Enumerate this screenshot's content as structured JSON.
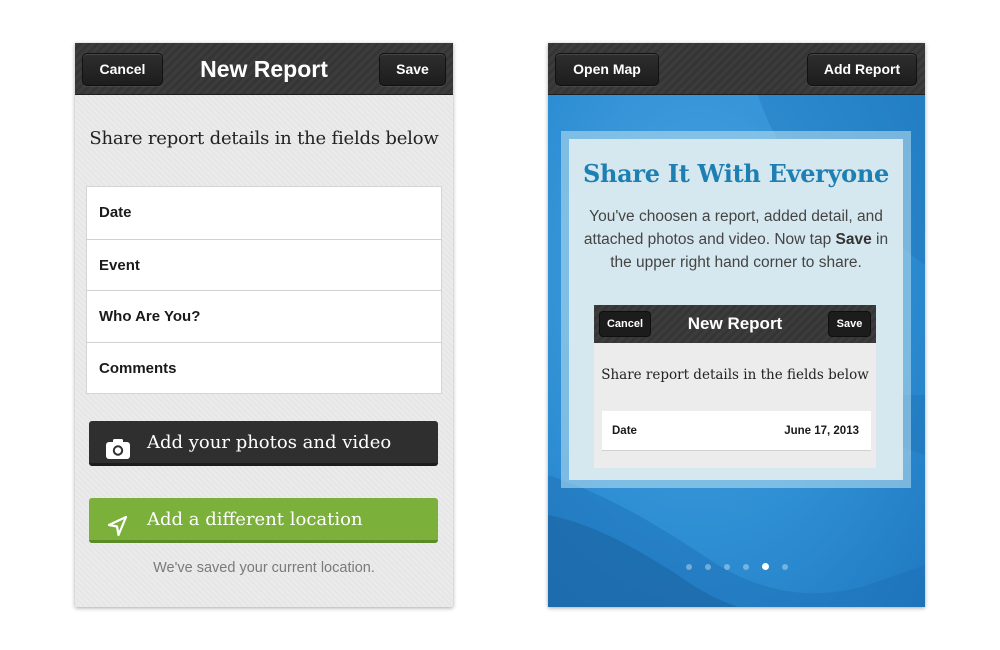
{
  "left_screen": {
    "header": {
      "cancel_label": "Cancel",
      "title": "New Report",
      "save_label": "Save"
    },
    "instructions": "Share report details in the fields below",
    "fields": [
      {
        "label": "Date"
      },
      {
        "label": "Event"
      },
      {
        "label": "Who Are You?"
      },
      {
        "label": "Comments"
      }
    ],
    "media_button": {
      "label": "Add your photos and video",
      "icon": "camera-icon"
    },
    "location_button": {
      "label": "Add a different location",
      "icon": "location-arrow-icon"
    },
    "location_note": "We've saved your current location."
  },
  "right_screen": {
    "header": {
      "open_map_label": "Open Map",
      "add_report_label": "Add Report"
    },
    "card": {
      "title": "Share It With Everyone",
      "body_part1": "You've choosen a report, added detail, and attached photos and video. Now tap ",
      "body_bold": "Save",
      "body_part2": " in the upper right hand corner to share."
    },
    "preview": {
      "cancel_label": "Cancel",
      "title": "New Report",
      "save_label": "Save",
      "instructions": "Share report details in the fields below",
      "field_label": "Date",
      "field_value": "June 17, 2013"
    },
    "pager": {
      "total": 6,
      "active_index": 4
    }
  },
  "colors": {
    "header_dark": "#3a3a3a",
    "location_green": "#7bb03a",
    "media_dark": "#2f2f2f",
    "ocean_blue": "#2f8fd4",
    "card_title_blue": "#1e7fb3"
  }
}
